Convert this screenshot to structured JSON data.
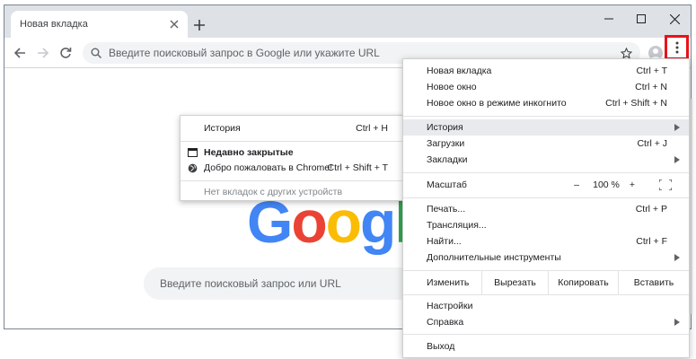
{
  "browser": {
    "tab_title": "Новая вкладка",
    "omnibox_placeholder": "Введите поисковый запрос в Google или укажите URL"
  },
  "page": {
    "logo_letters": [
      "G",
      "o",
      "o",
      "g",
      "l"
    ],
    "logo_colors": [
      "#4285f4",
      "#ea4335",
      "#fbbc05",
      "#4285f4",
      "#34a853"
    ],
    "search_placeholder": "Введите поисковый запрос или URL"
  },
  "history_submenu": {
    "header_label": "История",
    "header_shortcut": "Ctrl + H",
    "recently_closed": "Недавно закрытые",
    "welcome_item": "Добро пожаловать в Chrome!",
    "welcome_shortcut": "Ctrl + Shift + T",
    "no_tabs": "Нет вкладок с других устройств"
  },
  "menu": {
    "new_tab": "Новая вкладка",
    "new_tab_sc": "Ctrl + T",
    "new_window": "Новое окно",
    "new_window_sc": "Ctrl + N",
    "incognito": "Новое окно в режиме инкогнито",
    "incognito_sc": "Ctrl + Shift + N",
    "history": "История",
    "downloads": "Загрузки",
    "downloads_sc": "Ctrl + J",
    "bookmarks": "Закладки",
    "zoom_label": "Масштаб",
    "zoom_minus": "–",
    "zoom_value": "100 %",
    "zoom_plus": "+",
    "print": "Печать...",
    "print_sc": "Ctrl + P",
    "cast": "Трансляция...",
    "find": "Найти...",
    "find_sc": "Ctrl + F",
    "more_tools": "Дополнительные инструменты",
    "edit_label": "Изменить",
    "cut": "Вырезать",
    "copy": "Копировать",
    "paste": "Вставить",
    "settings": "Настройки",
    "help": "Справка",
    "exit": "Выход"
  },
  "colors": {
    "highlight_border": "#e8131a",
    "active_row": "#e8eaed"
  }
}
